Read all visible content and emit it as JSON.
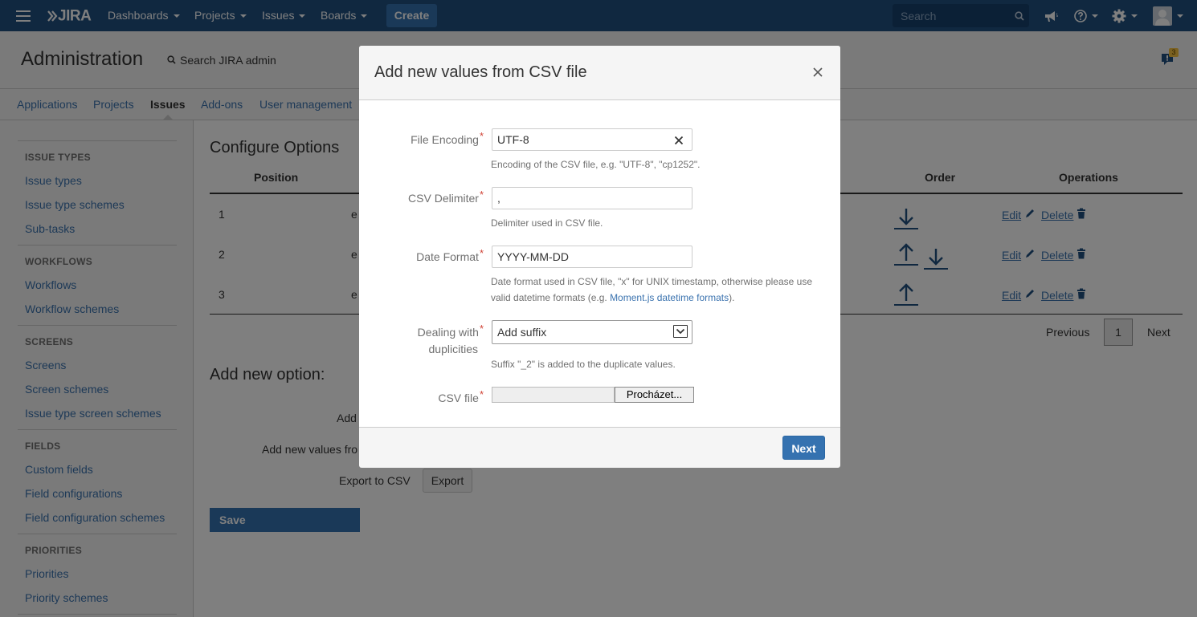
{
  "topnav": {
    "logo": "JIRA",
    "menus": [
      "Dashboards",
      "Projects",
      "Issues",
      "Boards"
    ],
    "create_label": "Create",
    "search_placeholder": "Search",
    "colors": {
      "bar": "#205081",
      "create": "#3572b0"
    }
  },
  "admin": {
    "title": "Administration",
    "search_label": "Search JIRA admin",
    "notification_count": "3",
    "tabs": [
      "Applications",
      "Projects",
      "Issues",
      "Add-ons",
      "User management"
    ],
    "active_tab": "Issues"
  },
  "sidebar": {
    "sections": [
      {
        "heading": "ISSUE TYPES",
        "items": [
          "Issue types",
          "Issue type schemes",
          "Sub-tasks"
        ]
      },
      {
        "heading": "WORKFLOWS",
        "items": [
          "Workflows",
          "Workflow schemes"
        ]
      },
      {
        "heading": "SCREENS",
        "items": [
          "Screens",
          "Screen schemes",
          "Issue type screen schemes"
        ]
      },
      {
        "heading": "FIELDS",
        "items": [
          "Custom fields",
          "Field configurations",
          "Field configuration schemes"
        ]
      },
      {
        "heading": "PRIORITIES",
        "items": [
          "Priorities",
          "Priority schemes"
        ]
      }
    ]
  },
  "content": {
    "title": "Configure Options",
    "columns": {
      "position": "Position",
      "order": "Order",
      "operations": "Operations"
    },
    "rows": [
      {
        "position": "1",
        "value_start": "e"
      },
      {
        "position": "2",
        "value_start": "e"
      },
      {
        "position": "3",
        "value_start": "e"
      }
    ],
    "edit_label": "Edit",
    "delete_label": "Delete",
    "pagination": {
      "previous": "Previous",
      "current": "1",
      "next": "Next"
    },
    "add_option_title": "Add new option:",
    "add_label": "Add",
    "add_from_label": "Add new values fro",
    "export_label": "Export to CSV",
    "export_button": "Export",
    "save_button": "Save"
  },
  "dialog": {
    "title": "Add new values from CSV file",
    "fields": {
      "encoding": {
        "label": "File Encoding",
        "value": "UTF-8",
        "help": "Encoding of the CSV file, e.g. \"UTF-8\", \"cp1252\"."
      },
      "delimiter": {
        "label": "CSV Delimiter",
        "value": ",",
        "help": "Delimiter used in CSV file."
      },
      "date_format": {
        "label": "Date Format",
        "value": "YYYY-MM-DD",
        "help_before": "Date format used in CSV file, \"x\" for UNIX timestamp, otherwise please use valid datetime formats (e.g. ",
        "help_link": "Moment.js datetime formats",
        "help_after": ")."
      },
      "duplicities": {
        "label_line1": "Dealing with",
        "label_line2": "duplicities",
        "value": "Add suffix",
        "help": "Suffix \"_2\" is added to the duplicate values."
      },
      "csv_file": {
        "label": "CSV file",
        "browse_label": "Procházet..."
      }
    },
    "required_mark": "*",
    "next_button": "Next"
  }
}
